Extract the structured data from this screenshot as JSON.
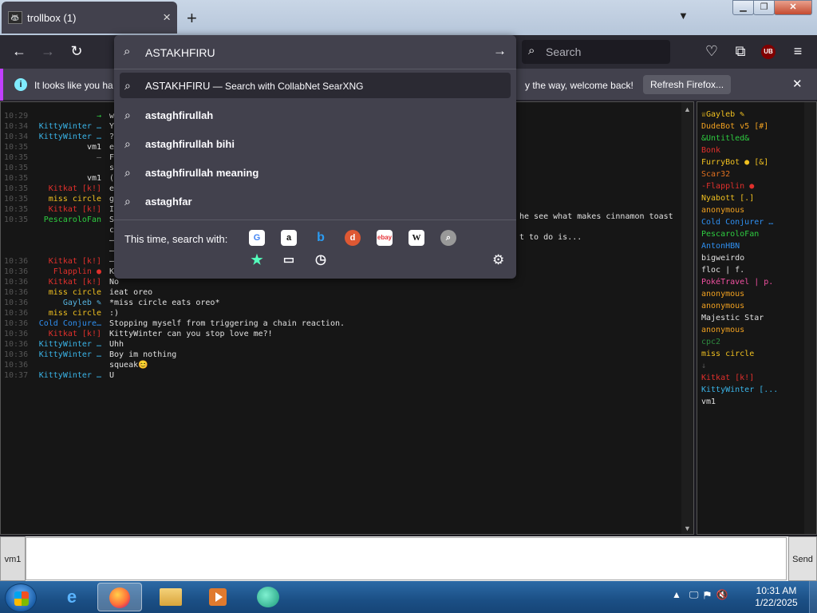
{
  "browser": {
    "tab_title": "trollbox (1)",
    "tab_favicon": "🦝",
    "new_tab": "+",
    "tab_list": "⌵",
    "search_placeholder": "Search",
    "ublock_label": "UB"
  },
  "notification": {
    "message_start": "It looks like you ha",
    "message_end": "y the way, welcome back!",
    "refresh_label": "Refresh Firefox...",
    "close": "✕",
    "accent_color": "#c13fff"
  },
  "urlbar": {
    "value": "ASTAKHFIRU",
    "suggestions": [
      {
        "text": "ASTAKHFIRU",
        "action": " — Search with CollabNet SearXNG"
      },
      {
        "text": "astaghfirullah"
      },
      {
        "text": "astaghfirullah bihi"
      },
      {
        "text": "astaghfirullah meaning"
      },
      {
        "text": "astaghfar"
      }
    ],
    "search_with_label": "This time, search with:",
    "engines": [
      "Google",
      "Amazon",
      "Bing",
      "DuckDuckGo",
      "eBay",
      "Wikipedia",
      "Search"
    ]
  },
  "chat": {
    "messages": [
      {
        "time": "10:29",
        "nick": "→",
        "text": "w",
        "color": "#2ecc40"
      },
      {
        "time": "10:34",
        "nick": "KittyWinter …",
        "text": "Y",
        "color": "#3ab4e8"
      },
      {
        "time": "10:34",
        "nick": "KittyWinter …",
        "text": "?",
        "color": "#3ab4e8"
      },
      {
        "time": "10:35",
        "nick": "vm1",
        "text": "e",
        "color": "#e0e0e0"
      },
      {
        "time": "10:35",
        "nick": "—",
        "text": "F",
        "color": "#888888"
      },
      {
        "time": "10:35",
        "nick": "",
        "text": "s",
        "color": "#888888"
      },
      {
        "time": "10:35",
        "nick": "vm1",
        "text": "(",
        "color": "#e0e0e0"
      },
      {
        "time": "10:35",
        "nick": "Kitkat [k!]",
        "text": "e",
        "color": "#e0302c"
      },
      {
        "time": "10:35",
        "nick": "miss circle",
        "text": "g",
        "color": "#f0c020"
      },
      {
        "time": "10:35",
        "nick": "Kitkat [k!]",
        "text": "I",
        "color": "#e0302c"
      },
      {
        "time": "10:35",
        "nick": "PescaroloFan",
        "text": "S",
        "color": "#2ecc40"
      },
      {
        "time": "",
        "nick": "",
        "text": "c",
        "color": "#888888"
      },
      {
        "time": "",
        "nick": "",
        "text": "—",
        "color": "#888888"
      },
      {
        "time": "",
        "nick": "",
        "text": "—",
        "color": "#888888"
      },
      {
        "time": "10:36",
        "nick": "Kitkat [k!]",
        "text": "—",
        "color": "#e0302c"
      },
      {
        "time": "10:36",
        "nick": "Flapplin ●",
        "text": "K",
        "color": "#e0302c"
      },
      {
        "time": "10:36",
        "nick": "Kitkat [k!]",
        "text": "No",
        "color": "#e0302c"
      },
      {
        "time": "10:36",
        "nick": "miss circle",
        "text": "ieat oreo",
        "color": "#f0c020"
      },
      {
        "time": "10:36",
        "nick": "Gayleb ✎",
        "text": "*miss circle eats oreo*",
        "color": "#56b4e0"
      },
      {
        "time": "10:36",
        "nick": "miss circle",
        "text": ":)",
        "color": "#f0c020"
      },
      {
        "time": "10:36",
        "nick": "Cold Conjure…",
        "text": "Stopping myself from triggering a chain reaction.",
        "color": "#2f8ff0"
      },
      {
        "time": "10:36",
        "nick": "Kitkat [k!]",
        "text": "KittyWinter can you stop love me?!",
        "color": "#e0302c"
      },
      {
        "time": "10:36",
        "nick": "KittyWinter …",
        "text": "Uhh",
        "color": "#3ab4e8"
      },
      {
        "time": "10:36",
        "nick": "KittyWinter …",
        "text": "Boy im nothing",
        "color": "#3ab4e8"
      },
      {
        "time": "10:36",
        "nick": "",
        "text": "squeak😊",
        "color": "#888888"
      },
      {
        "time": "10:37",
        "nick": "KittyWinter …",
        "text": "U",
        "color": "#3ab4e8"
      }
    ],
    "tail_text_1": "he see what makes cinnamon toast",
    "tail_text_2": "t to do is..."
  },
  "users": [
    {
      "name": "♕Gayleb ✎",
      "color": "#f0c020"
    },
    {
      "name": "DudeBot v5 [#]",
      "color": "#f0a020"
    },
    {
      "name": "&Untitled&",
      "color": "#2ecc40"
    },
    {
      "name": "Bonk",
      "color": "#e0302c"
    },
    {
      "name": "FurryBot ● [&]",
      "color": "#f0c020"
    },
    {
      "name": "Scar32",
      "color": "#e07020"
    },
    {
      "name": "-Flapplin ●",
      "color": "#e0302c"
    },
    {
      "name": "Nyabott [.]",
      "color": "#f0c020"
    },
    {
      "name": "anonymous",
      "color": "#f0a020"
    },
    {
      "name": "Cold Conjurer …",
      "color": "#2f8ff0"
    },
    {
      "name": "PescaroloFan",
      "color": "#2ecc40"
    },
    {
      "name": "AntonHBN",
      "color": "#2f8ff0"
    },
    {
      "name": "bigweirdo",
      "color": "#e0e0e0"
    },
    {
      "name": "floc | f.",
      "color": "#e0e0e0"
    },
    {
      "name": "PokéTravel | p.",
      "color": "#f050a0"
    },
    {
      "name": "anonymous",
      "color": "#f0a020"
    },
    {
      "name": "anonymous",
      "color": "#f0a020"
    },
    {
      "name": "Majestic Star",
      "color": "#e0e0e0"
    },
    {
      "name": "anonymous",
      "color": "#f0a020"
    },
    {
      "name": "cpc2",
      "color": "#2e8b40"
    },
    {
      "name": "miss circle",
      "color": "#f0c020"
    },
    {
      "name": "↓",
      "color": "#555555"
    },
    {
      "name": "Kitkat [k!]",
      "color": "#e0302c"
    },
    {
      "name": "KittyWinter [...",
      "color": "#3ab4e8"
    },
    {
      "name": "vm1",
      "color": "#e0e0e0"
    }
  ],
  "input": {
    "nick": "vm1",
    "send_label": "Send",
    "value": ""
  },
  "taskbar": {
    "time": "10:31 AM",
    "date": "1/22/2025"
  }
}
